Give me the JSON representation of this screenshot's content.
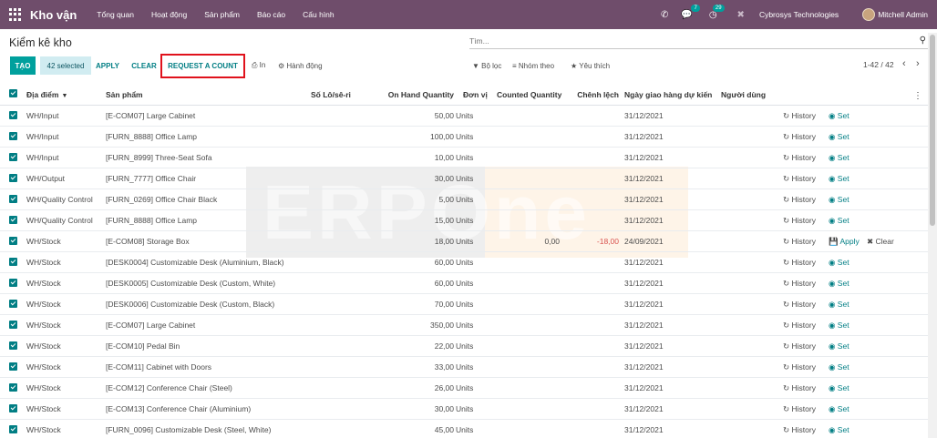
{
  "navbar": {
    "brand": "Kho vận",
    "menu": [
      "Tổng quan",
      "Hoạt động",
      "Sản phẩm",
      "Báo cáo",
      "Cấu hình"
    ],
    "messages_badge": "7",
    "activity_badge": "29",
    "company": "Cybrosys Technologies",
    "user": "Mitchell Admin"
  },
  "control": {
    "title": "Kiểm kê kho",
    "search_placeholder": "Tìm...",
    "create_label": "TẠO",
    "selected_label": "42 selected",
    "apply_label": "APPLY",
    "clear_label": "CLEAR",
    "request_label": "REQUEST A COUNT",
    "print_label": "In",
    "action_label": "Hành động",
    "filter_label": "Bộ lọc",
    "groupby_label": "Nhóm theo",
    "favorite_label": "Yêu thích",
    "pager": "1-42 / 42"
  },
  "table": {
    "headers": {
      "location": "Địa điểm",
      "product": "Sản phẩm",
      "lot": "Số Lô/sê-ri",
      "onhand": "On Hand Quantity",
      "uom": "Đơn vị",
      "counted": "Counted Quantity",
      "diff": "Chênh lệch",
      "date": "Ngày giao hàng dự kiến",
      "user": "Người dùng"
    },
    "history_label": "History",
    "set_label": "Set",
    "apply_label": "Apply",
    "clear_label": "Clear",
    "rows": [
      {
        "location": "WH/Input",
        "product": "[E-COM07] Large Cabinet",
        "onhand": "50,00",
        "uom": "Units",
        "counted": "",
        "diff": "",
        "date": "31/12/2021"
      },
      {
        "location": "WH/Input",
        "product": "[FURN_8888] Office Lamp",
        "onhand": "100,00",
        "uom": "Units",
        "counted": "",
        "diff": "",
        "date": "31/12/2021"
      },
      {
        "location": "WH/Input",
        "product": "[FURN_8999] Three-Seat Sofa",
        "onhand": "10,00",
        "uom": "Units",
        "counted": "",
        "diff": "",
        "date": "31/12/2021"
      },
      {
        "location": "WH/Output",
        "product": "[FURN_7777] Office Chair",
        "onhand": "30,00",
        "uom": "Units",
        "counted": "",
        "diff": "",
        "date": "31/12/2021"
      },
      {
        "location": "WH/Quality Control",
        "product": "[FURN_0269] Office Chair Black",
        "onhand": "5,00",
        "uom": "Units",
        "counted": "",
        "diff": "",
        "date": "31/12/2021"
      },
      {
        "location": "WH/Quality Control",
        "product": "[FURN_8888] Office Lamp",
        "onhand": "15,00",
        "uom": "Units",
        "counted": "",
        "diff": "",
        "date": "31/12/2021"
      },
      {
        "location": "WH/Stock",
        "product": "[E-COM08] Storage Box",
        "onhand": "18,00",
        "uom": "Units",
        "counted": "0,00",
        "diff": "-18,00",
        "date": "24/09/2021",
        "pending": true
      },
      {
        "location": "WH/Stock",
        "product": "[DESK0004] Customizable Desk (Aluminium, Black)",
        "onhand": "60,00",
        "uom": "Units",
        "counted": "",
        "diff": "",
        "date": "31/12/2021"
      },
      {
        "location": "WH/Stock",
        "product": "[DESK0005] Customizable Desk (Custom, White)",
        "onhand": "60,00",
        "uom": "Units",
        "counted": "",
        "diff": "",
        "date": "31/12/2021"
      },
      {
        "location": "WH/Stock",
        "product": "[DESK0006] Customizable Desk (Custom, Black)",
        "onhand": "70,00",
        "uom": "Units",
        "counted": "",
        "diff": "",
        "date": "31/12/2021"
      },
      {
        "location": "WH/Stock",
        "product": "[E-COM07] Large Cabinet",
        "onhand": "350,00",
        "uom": "Units",
        "counted": "",
        "diff": "",
        "date": "31/12/2021"
      },
      {
        "location": "WH/Stock",
        "product": "[E-COM10] Pedal Bin",
        "onhand": "22,00",
        "uom": "Units",
        "counted": "",
        "diff": "",
        "date": "31/12/2021"
      },
      {
        "location": "WH/Stock",
        "product": "[E-COM11] Cabinet with Doors",
        "onhand": "33,00",
        "uom": "Units",
        "counted": "",
        "diff": "",
        "date": "31/12/2021"
      },
      {
        "location": "WH/Stock",
        "product": "[E-COM12] Conference Chair (Steel)",
        "onhand": "26,00",
        "uom": "Units",
        "counted": "",
        "diff": "",
        "date": "31/12/2021"
      },
      {
        "location": "WH/Stock",
        "product": "[E-COM13] Conference Chair (Aluminium)",
        "onhand": "30,00",
        "uom": "Units",
        "counted": "",
        "diff": "",
        "date": "31/12/2021"
      },
      {
        "location": "WH/Stock",
        "product": "[FURN_0096] Customizable Desk (Steel, White)",
        "onhand": "45,00",
        "uom": "Units",
        "counted": "",
        "diff": "",
        "date": "31/12/2021"
      }
    ]
  },
  "watermark": "ERPOne",
  "colors": {
    "navbar": "#6f4d6b",
    "primary": "#017e84",
    "create_button": "#00a09d",
    "highlight_border": "#e0121c",
    "negative": "#d9534f"
  }
}
